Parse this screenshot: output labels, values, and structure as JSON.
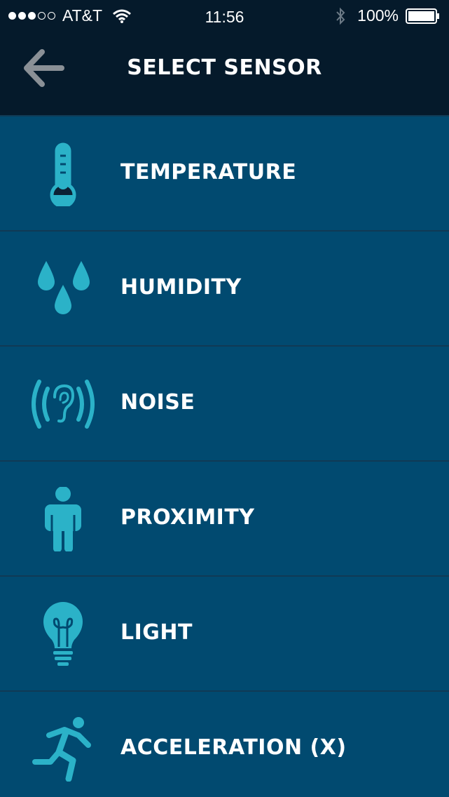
{
  "status_bar": {
    "carrier": "AT&T",
    "time": "11:56",
    "battery": "100%",
    "signal_strength": 3
  },
  "header": {
    "title": "SELECT SENSOR",
    "back_icon": "arrow-left-icon"
  },
  "colors": {
    "nav_background": "#051a2b",
    "row_background": "#014a70",
    "icon_accent": "#2bb2c8"
  },
  "sensors": [
    {
      "label": "TEMPERATURE",
      "icon": "thermometer-icon"
    },
    {
      "label": "HUMIDITY",
      "icon": "water-drops-icon"
    },
    {
      "label": "NOISE",
      "icon": "ear-sound-icon"
    },
    {
      "label": "PROXIMITY",
      "icon": "person-icon"
    },
    {
      "label": "LIGHT",
      "icon": "light-bulb-icon"
    },
    {
      "label": "ACCELERATION (X)",
      "icon": "running-person-icon"
    }
  ]
}
